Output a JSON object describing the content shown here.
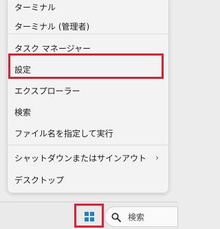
{
  "menu": {
    "items": [
      {
        "label": "ターミナル"
      },
      {
        "label": "ターミナル (管理者)"
      },
      {
        "label": "タスク マネージャー"
      },
      {
        "label": "設定"
      },
      {
        "label": "エクスプローラー"
      },
      {
        "label": "検索"
      },
      {
        "label": "ファイル名を指定して実行"
      },
      {
        "label": "シャットダウンまたはサインアウト"
      },
      {
        "label": "デスクトップ"
      }
    ],
    "submenu_arrow": "›"
  },
  "taskbar": {
    "search_placeholder": "検索"
  },
  "colors": {
    "highlight": "#e0202f",
    "windows_blue": "#1d80d7"
  }
}
